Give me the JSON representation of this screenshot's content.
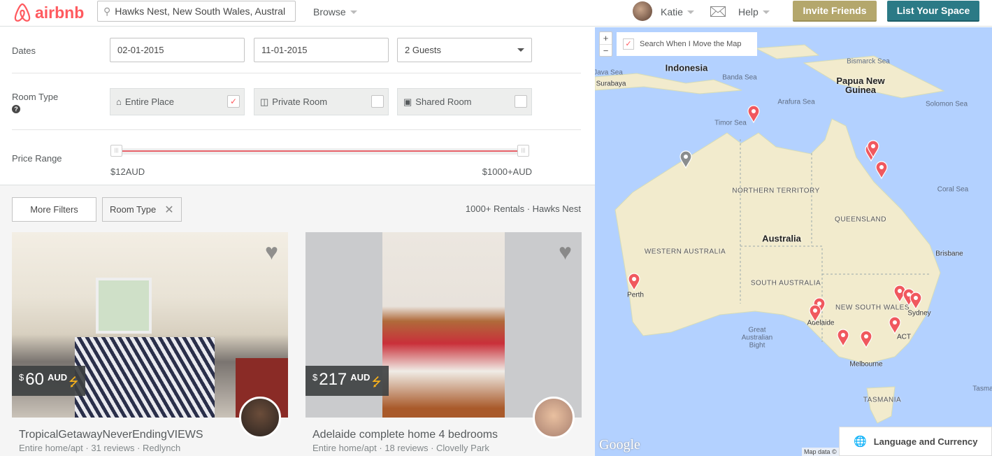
{
  "header": {
    "logo_text": "airbnb",
    "search_value": "Hawks Nest, New South Wales, Austral",
    "browse_label": "Browse",
    "user_name": "Katie",
    "help_label": "Help",
    "invite_label": "Invite Friends",
    "list_space_label": "List Your Space"
  },
  "filters": {
    "dates_label": "Dates",
    "checkin": "02-01-2015",
    "checkout": "11-01-2015",
    "guests": "2 Guests",
    "room_type_label": "Room Type",
    "room_types": [
      {
        "label": "Entire Place",
        "checked": true
      },
      {
        "label": "Private Room",
        "checked": false
      },
      {
        "label": "Shared Room",
        "checked": false
      }
    ],
    "price_range_label": "Price Range",
    "price_min": "$12AUD",
    "price_max": "$1000+AUD"
  },
  "filter_bar": {
    "more_filters": "More Filters",
    "active_filter": "Room Type",
    "results": "1000+ Rentals · Hawks Nest"
  },
  "listings": [
    {
      "currency": "$",
      "price": "60",
      "unit": "AUD",
      "title": "TropicalGetawayNeverEndingVIEWS",
      "subtitle": "Entire home/apt · 31 reviews · Redlynch",
      "instant_book": true
    },
    {
      "currency": "$",
      "price": "217",
      "unit": "AUD",
      "title": "Adelaide complete home 4 bedrooms",
      "subtitle": "Entire home/apt · 18 reviews · Clovelly Park",
      "instant_book": true
    }
  ],
  "map": {
    "zoom_in": "+",
    "zoom_out": "−",
    "search_when_move": "Search When I Move the Map",
    "search_when_move_checked": true,
    "labels": [
      "Indonesia",
      "Banda Sea",
      "Java Sea",
      "Surabaya",
      "Timor Sea",
      "Arafura Sea",
      "Bismarck Sea",
      "Papua New Guinea",
      "Solomon Sea",
      "Coral Sea",
      "NORTHERN TERRITORY",
      "QUEENSLAND",
      "Australia",
      "WESTERN AUSTRALIA",
      "SOUTH AUSTRALIA",
      "NEW SOUTH WALES",
      "Brisbane",
      "Great Australian Bight",
      "Melbourne",
      "TASMANIA",
      "Tasma",
      "Adelaide",
      "Perth",
      "Sydney",
      "ACT"
    ],
    "google_logo": "Google",
    "map_data": "Map data ©",
    "language_currency": "Language and Currency",
    "pin_color": "#f0585e"
  },
  "colors": {
    "brand": "#ff5a5f",
    "invite": "#b4a76c",
    "list_space": "#2b7a86"
  }
}
